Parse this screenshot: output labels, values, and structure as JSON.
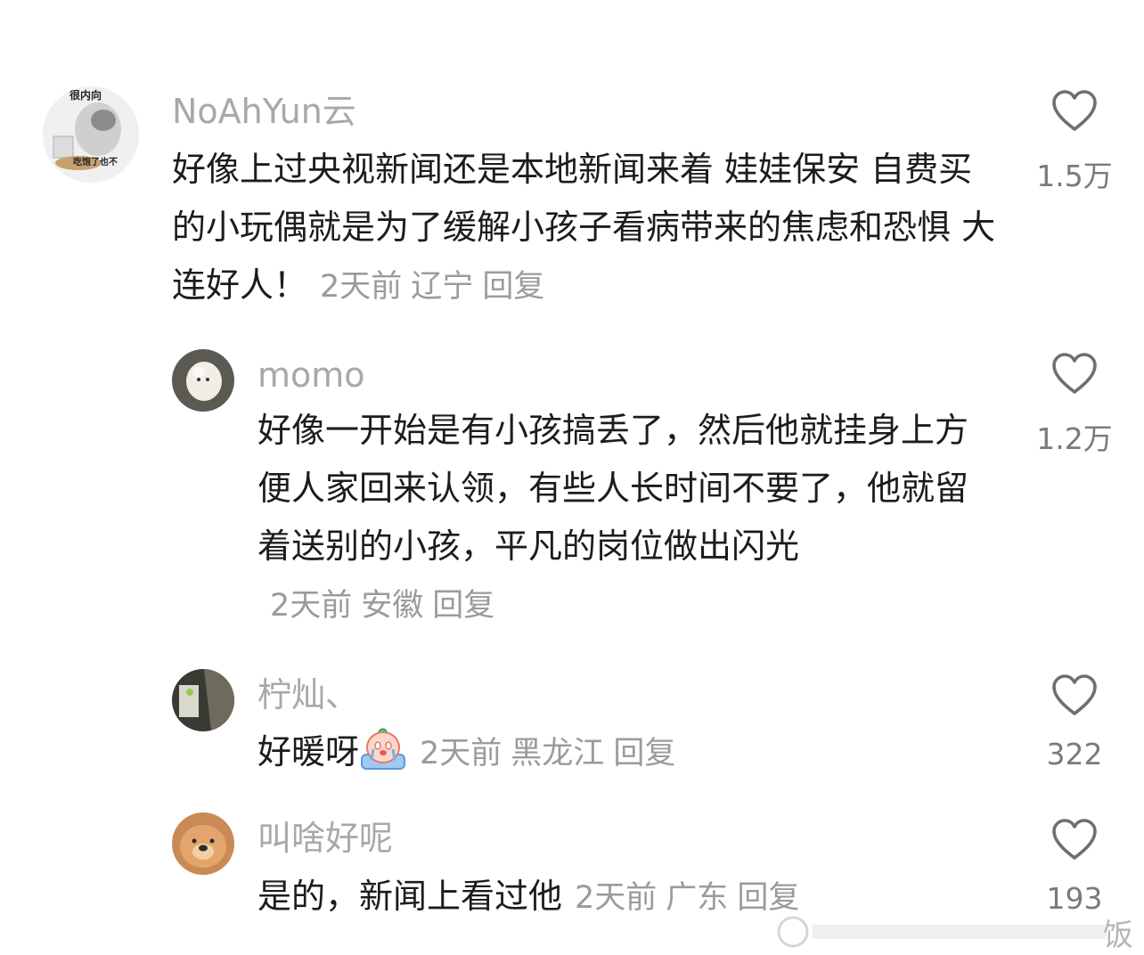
{
  "comments": [
    {
      "username": "NoAhYun云",
      "avatar_text_top": "很内向",
      "avatar_text_bottom": "吃饱了也不",
      "text": "好像上过央视新闻还是本地新闻来着  娃娃保安 自费买的小玩偶就是为了缓解小孩子看病带来的焦虑和恐惧 大连好人！",
      "time": "2天前",
      "location": "辽宁",
      "reply": "回复",
      "likes": "1.5万"
    },
    {
      "username": "momo",
      "text": "好像一开始是有小孩搞丢了，然后他就挂身上方便人家回来认领，有些人长时间不要了，他就留着送别的小孩，平凡的岗位做出闪光",
      "time": "2天前",
      "location": "安徽",
      "reply": "回复",
      "likes": "1.2万"
    },
    {
      "username": "柠灿、",
      "text": "好暖呀",
      "emoji": "crying-face-emoji",
      "time": "2天前",
      "location": "黑龙江",
      "reply": "回复",
      "likes": "322"
    },
    {
      "username": "叫啥好呢",
      "text": "是的，新闻上看过他",
      "time": "2天前",
      "location": "广东",
      "reply": "回复",
      "likes": "193"
    }
  ],
  "watermark": "饭",
  "colors": {
    "username": "#a8a8a8",
    "text": "#1c1c1c",
    "meta": "#9b9b9b",
    "heart": "#6f6f6f"
  }
}
